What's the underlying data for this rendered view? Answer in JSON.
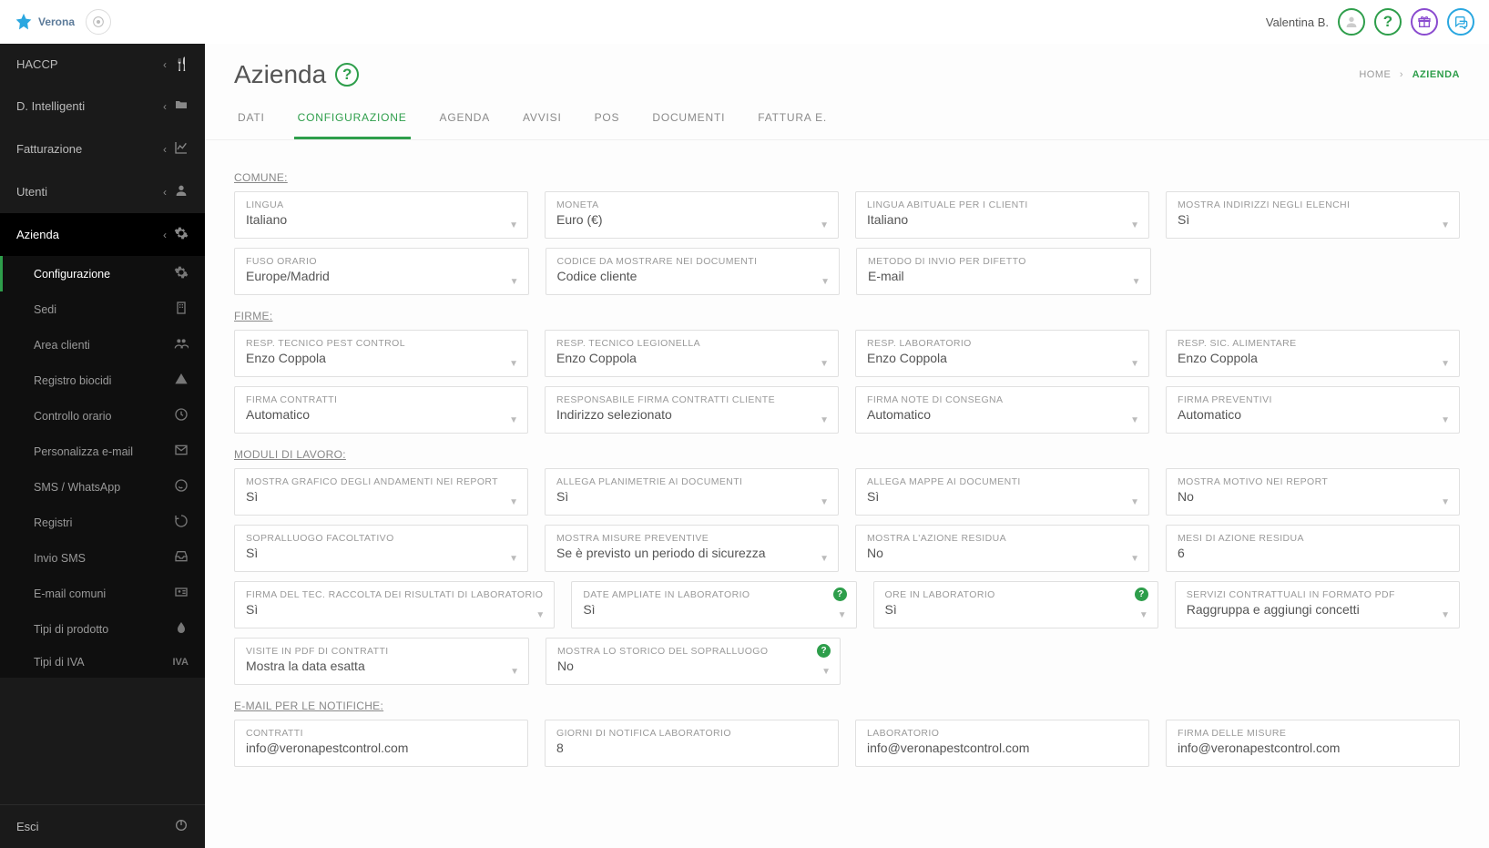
{
  "topbar": {
    "brand": "Verona",
    "user": "Valentina B."
  },
  "breadcrumb": {
    "home": "HOME",
    "current": "AZIENDA"
  },
  "page_title": "Azienda",
  "sidebar": {
    "items": [
      {
        "label": "HACCP"
      },
      {
        "label": "D. Intelligenti"
      },
      {
        "label": "Fatturazione"
      },
      {
        "label": "Utenti"
      },
      {
        "label": "Azienda"
      }
    ],
    "sub": [
      {
        "label": "Configurazione"
      },
      {
        "label": "Sedi"
      },
      {
        "label": "Area clienti"
      },
      {
        "label": "Registro biocidi"
      },
      {
        "label": "Controllo orario"
      },
      {
        "label": "Personalizza e-mail"
      },
      {
        "label": "SMS / WhatsApp"
      },
      {
        "label": "Registri"
      },
      {
        "label": "Invio SMS"
      },
      {
        "label": "E-mail comuni"
      },
      {
        "label": "Tipi di prodotto"
      },
      {
        "label": "Tipi di IVA",
        "badge": "IVA"
      }
    ],
    "exit": "Esci"
  },
  "tabs": [
    "DATI",
    "CONFIGURAZIONE",
    "AGENDA",
    "AVVISI",
    "POS",
    "DOCUMENTI",
    "FATTURA E."
  ],
  "sections": {
    "comune": {
      "title": "COMUNE:",
      "r1": [
        {
          "label": "LINGUA",
          "value": "Italiano"
        },
        {
          "label": "MONETA",
          "value": "Euro (€)"
        },
        {
          "label": "LINGUA ABITUALE PER I CLIENTI",
          "value": "Italiano"
        },
        {
          "label": "MOSTRA INDIRIZZI NEGLI ELENCHI",
          "value": "Sì"
        }
      ],
      "r2": [
        {
          "label": "FUSO ORARIO",
          "value": "Europe/Madrid"
        },
        {
          "label": "CODICE DA MOSTRARE NEI DOCUMENTI",
          "value": "Codice cliente"
        },
        {
          "label": "METODO DI INVIO PER DIFETTO",
          "value": "E-mail"
        }
      ]
    },
    "firme": {
      "title": "FIRME:",
      "r1": [
        {
          "label": "RESP. TECNICO PEST CONTROL",
          "value": "Enzo Coppola"
        },
        {
          "label": "RESP. TECNICO LEGIONELLA",
          "value": "Enzo Coppola"
        },
        {
          "label": "RESP. LABORATORIO",
          "value": "Enzo Coppola"
        },
        {
          "label": "RESP. SIC. ALIMENTARE",
          "value": "Enzo Coppola"
        }
      ],
      "r2": [
        {
          "label": "FIRMA CONTRATTI",
          "value": "Automatico"
        },
        {
          "label": "RESPONSABILE FIRMA CONTRATTI CLIENTE",
          "value": "Indirizzo selezionato"
        },
        {
          "label": "FIRMA NOTE DI CONSEGNA",
          "value": "Automatico"
        },
        {
          "label": "FIRMA PREVENTIVI",
          "value": "Automatico"
        }
      ]
    },
    "moduli": {
      "title": "MODULI DI LAVORO:",
      "r1": [
        {
          "label": "MOSTRA GRAFICO DEGLI ANDAMENTI NEI REPORT",
          "value": "Sì"
        },
        {
          "label": "ALLEGA PLANIMETRIE AI DOCUMENTI",
          "value": "Sì"
        },
        {
          "label": "ALLEGA MAPPE AI DOCUMENTI",
          "value": "Sì"
        },
        {
          "label": "MOSTRA MOTIVO NEI REPORT",
          "value": "No"
        }
      ],
      "r2": [
        {
          "label": "SOPRALLUOGO FACOLTATIVO",
          "value": "Sì"
        },
        {
          "label": "MOSTRA MISURE PREVENTIVE",
          "value": "Se è previsto un periodo di sicurezza"
        },
        {
          "label": "MOSTRA L'AZIONE RESIDUA",
          "value": "No"
        },
        {
          "label": "MESI DI AZIONE RESIDUA",
          "value": "6"
        }
      ],
      "r3": [
        {
          "label": "FIRMA DEL TEC. RACCOLTA DEI RISULTATI DI LABORATORIO",
          "value": "Sì"
        },
        {
          "label": "DATE AMPLIATE IN LABORATORIO",
          "value": "Sì",
          "help": true
        },
        {
          "label": "ORE IN LABORATORIO",
          "value": "Sì",
          "help": true
        },
        {
          "label": "SERVIZI CONTRATTUALI IN FORMATO PDF",
          "value": "Raggruppa e aggiungi concetti"
        }
      ],
      "r4": [
        {
          "label": "VISITE IN PDF DI CONTRATTI",
          "value": "Mostra la data esatta"
        },
        {
          "label": "MOSTRA LO STORICO DEL SOPRALLUOGO",
          "value": "No",
          "help": true
        }
      ]
    },
    "email": {
      "title": "E-MAIL PER LE NOTIFICHE:",
      "r1": [
        {
          "label": "CONTRATTI",
          "value": "info@veronapestcontrol.com"
        },
        {
          "label": "GIORNI DI NOTIFICA LABORATORIO",
          "value": "8"
        },
        {
          "label": "LABORATORIO",
          "value": "info@veronapestcontrol.com"
        },
        {
          "label": "FIRMA DELLE MISURE",
          "value": "info@veronapestcontrol.com"
        }
      ]
    }
  }
}
